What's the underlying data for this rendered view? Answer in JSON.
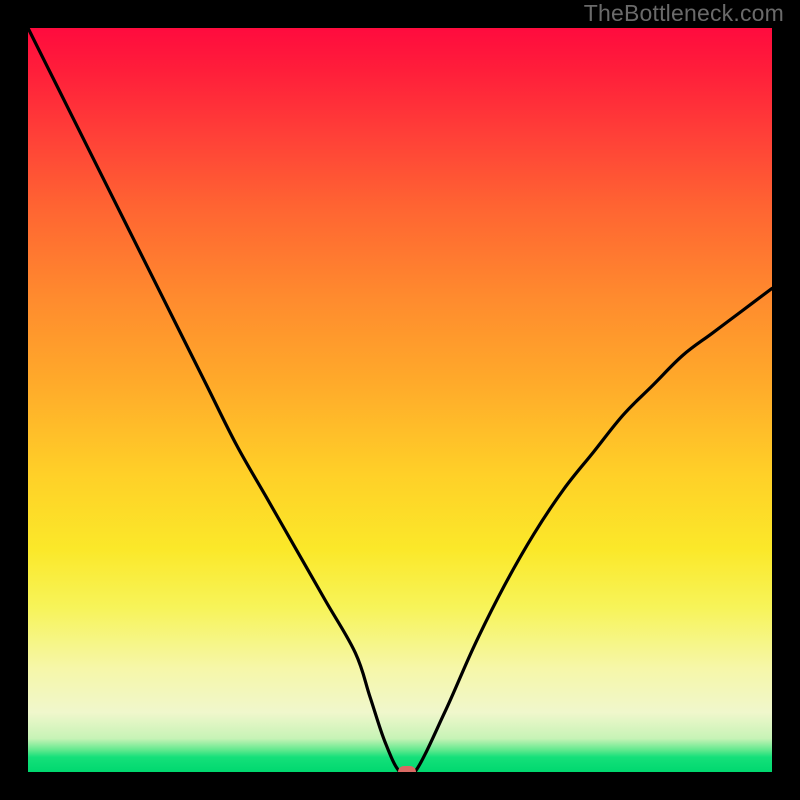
{
  "watermark": "TheBottleneck.com",
  "chart_data": {
    "type": "line",
    "title": "",
    "xlabel": "",
    "ylabel": "",
    "xlim": [
      0,
      100
    ],
    "ylim": [
      0,
      100
    ],
    "x": [
      0,
      4,
      8,
      12,
      16,
      20,
      24,
      28,
      32,
      36,
      40,
      44,
      46,
      48,
      50,
      52,
      56,
      60,
      64,
      68,
      72,
      76,
      80,
      84,
      88,
      92,
      96,
      100
    ],
    "y": [
      100,
      92,
      84,
      76,
      68,
      60,
      52,
      44,
      37,
      30,
      23,
      16,
      10,
      4,
      0,
      0,
      8,
      17,
      25,
      32,
      38,
      43,
      48,
      52,
      56,
      59,
      62,
      65
    ],
    "marker": {
      "x": 51,
      "y": 0
    },
    "background_gradient": {
      "top": "#ff0b3e",
      "mid1": "#ff8a2e",
      "mid2": "#fbe829",
      "bottom": "#00d86f"
    }
  }
}
